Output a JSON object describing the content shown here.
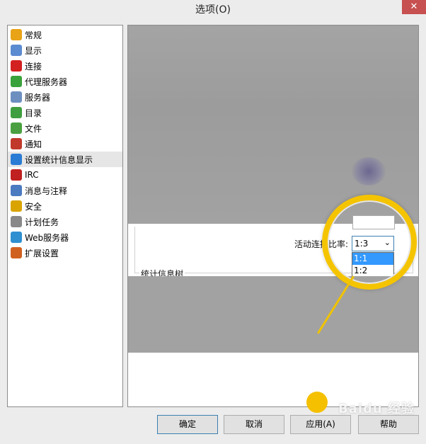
{
  "window": {
    "title": "选项(O)",
    "close_glyph": "✕"
  },
  "sidebar": {
    "items": [
      {
        "label": "常规",
        "icon": "gear-icon",
        "color": "#e8a317"
      },
      {
        "label": "显示",
        "icon": "monitor-icon",
        "color": "#5b8bd1"
      },
      {
        "label": "连接",
        "icon": "connection-icon",
        "color": "#d32020"
      },
      {
        "label": "代理服务器",
        "icon": "proxy-icon",
        "color": "#3aa23a"
      },
      {
        "label": "服务器",
        "icon": "server-icon",
        "color": "#6d8fc0"
      },
      {
        "label": "目录",
        "icon": "folder-icon",
        "color": "#3f9e3f"
      },
      {
        "label": "文件",
        "icon": "file-icon",
        "color": "#4aa040"
      },
      {
        "label": "通知",
        "icon": "notify-icon",
        "color": "#c0392b"
      },
      {
        "label": "设置统计信息显示",
        "icon": "statistics-icon",
        "color": "#2a7bd4"
      },
      {
        "label": "IRC",
        "icon": "irc-icon",
        "color": "#c02020"
      },
      {
        "label": "消息与注释",
        "icon": "message-icon",
        "color": "#4a7ac0"
      },
      {
        "label": "安全",
        "icon": "lock-icon",
        "color": "#d9a400"
      },
      {
        "label": "计划任务",
        "icon": "calendar-icon",
        "color": "#888888"
      },
      {
        "label": "Web服务器",
        "icon": "globe-icon",
        "color": "#2f8fd0"
      },
      {
        "label": "扩展设置",
        "icon": "extension-icon",
        "color": "#d06020"
      }
    ]
  },
  "content": {
    "ratio_label": "活动连接比率:",
    "ratio_select": {
      "value": "1:3",
      "chevron": "⌄"
    },
    "ratio_options": [
      "1:1",
      "1:2"
    ],
    "tree_group_label": "统计信息树"
  },
  "buttons": {
    "ok": "确定",
    "cancel": "取消",
    "apply": "应用(A)",
    "help": "帮助"
  },
  "watermark": {
    "text": "Baidu 经验"
  },
  "colors": {
    "accent": "#f5c400",
    "highlight": "#3399ff"
  }
}
